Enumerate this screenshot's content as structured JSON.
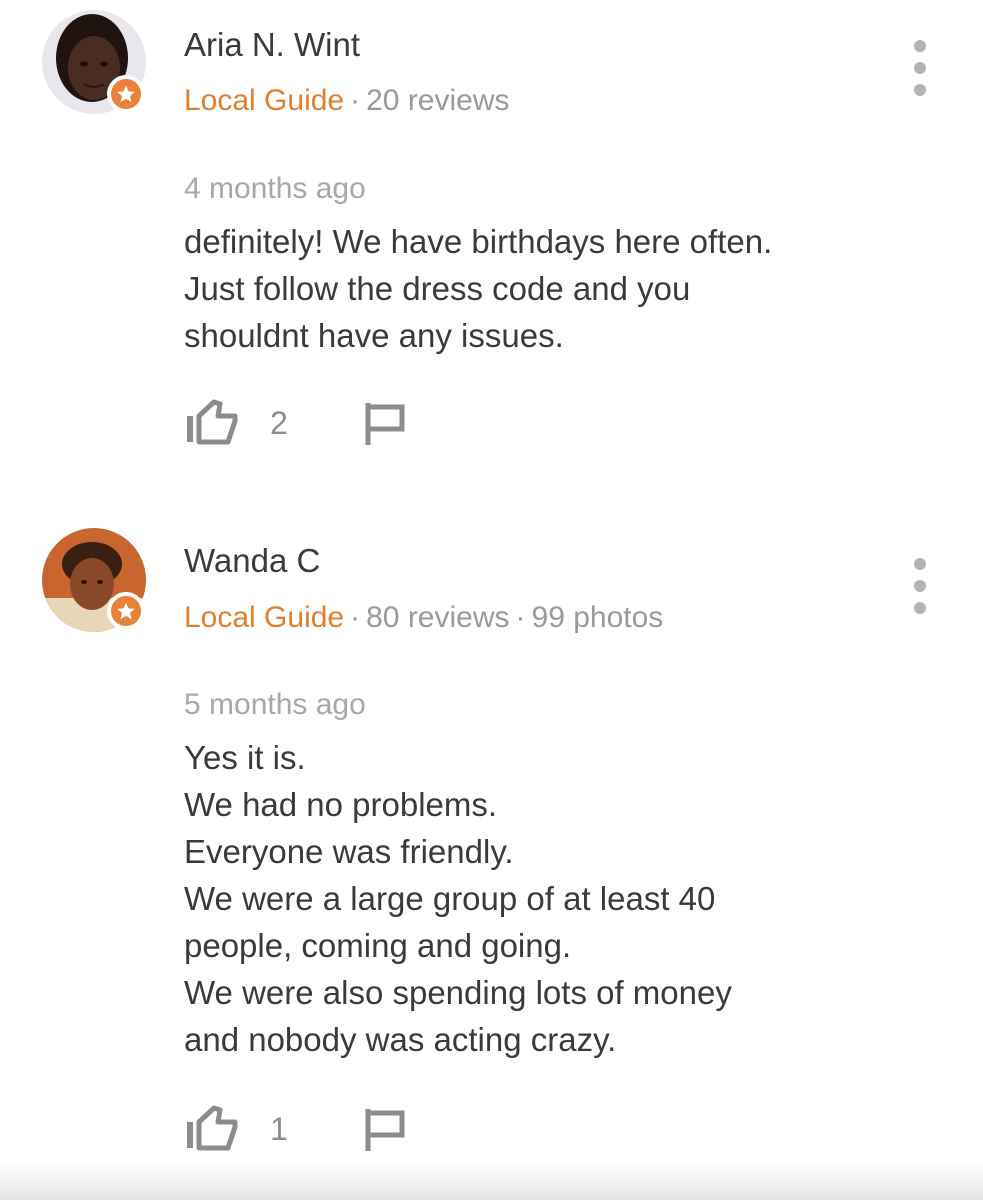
{
  "answers": [
    {
      "author": "Aria N. Wint",
      "guide_label": "Local Guide",
      "stats": [
        "20 reviews"
      ],
      "separator": "·",
      "date": "4 months ago",
      "lines": [
        "definitely! We have birthdays here often.",
        "Just follow the dress code and you",
        "shouldnt have any issues."
      ],
      "likes": "2",
      "avatar_colors": {
        "bg": "#e9e6ec",
        "face": "#4a2c22",
        "hair": "#1f1410"
      }
    },
    {
      "author": "Wanda C",
      "guide_label": "Local Guide",
      "stats": [
        "80 reviews",
        "99 photos"
      ],
      "separator": "·",
      "date": "5 months ago",
      "lines": [
        "Yes it is.",
        "We had no problems.",
        "Everyone was friendly.",
        "We were a large group of at least 40",
        "people, coming and going.",
        "We were also spending lots of money",
        "and nobody was acting crazy."
      ],
      "likes": "1",
      "avatar_colors": {
        "bg": "#c9652f",
        "face": "#8a4a2a",
        "hair": "#3b1f12"
      }
    }
  ],
  "icons": {
    "badge": "local-guide-star-icon",
    "like": "thumbs-up-icon",
    "flag": "flag-icon",
    "more": "more-vert-icon"
  },
  "colors": {
    "accent": "#e0802e",
    "text": "#3a3a3a",
    "muted": "#9a9a9a",
    "icon": "#8c8c8c"
  }
}
